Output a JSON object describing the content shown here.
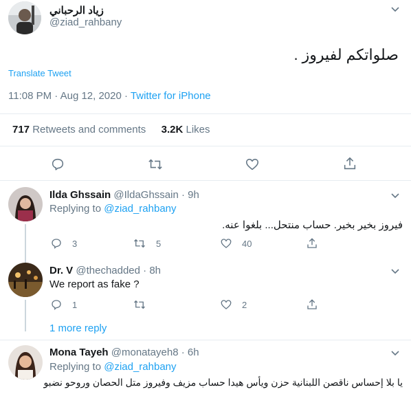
{
  "main_tweet": {
    "author_name": "زياد الرحباني",
    "handle": "@ziad_rahbany",
    "text": "صلواتكم لفيروز .",
    "translate_label": "Translate Tweet",
    "timestamp": "11:08 PM · Aug 12, 2020 · ",
    "source": "Twitter for iPhone",
    "retweets_count": "717",
    "retweets_label": "Retweets and comments",
    "likes_count": "3.2K",
    "likes_label": "Likes"
  },
  "replies": [
    {
      "name": "Ilda Ghssain",
      "handle": "@IldaGhssain",
      "time": "· 9h",
      "replying_label": "Replying to",
      "replying_to": "@ziad_rahbany",
      "text": "فيروز بخير بخير. حساب منتحل... بلغوا عنه.",
      "comments": "3",
      "retweets": "5",
      "likes": "40"
    },
    {
      "name": "Dr. V",
      "handle": "@thechadded",
      "time": "· 8h",
      "text": "We report as fake ?",
      "comments": "1",
      "retweets": "",
      "likes": "2"
    },
    {
      "name": "Mona Tayeh",
      "handle": "@monatayeh8",
      "time": "· 6h",
      "replying_label": "Replying to",
      "replying_to": "@ziad_rahbany",
      "text": "يا بلا إحساس ناقصن اللبنانية حزن ويأس هيدا حساب مزيف وفيروز متل الحصان وروحو نضبو"
    }
  ],
  "more_replies_label": "1 more reply",
  "colors": {
    "accent": "#1da1f2",
    "muted": "#657786",
    "border": "#e6ecf0"
  }
}
